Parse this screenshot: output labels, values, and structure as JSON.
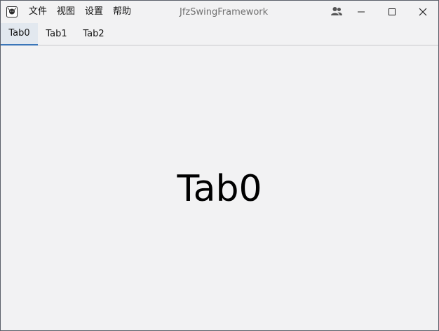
{
  "window": {
    "title": "JfzSwingFramework",
    "menu": [
      {
        "label": "文件"
      },
      {
        "label": "视图"
      },
      {
        "label": "设置"
      },
      {
        "label": "帮助"
      }
    ],
    "controls": {
      "users_icon": "users-icon",
      "minimize_icon": "minimize-icon",
      "maximize_icon": "maximize-icon",
      "close_icon": "close-icon"
    }
  },
  "tabs": [
    {
      "label": "Tab0",
      "selected": true
    },
    {
      "label": "Tab1",
      "selected": false
    },
    {
      "label": "Tab2",
      "selected": false
    }
  ],
  "content": {
    "heading": "Tab0"
  },
  "colors": {
    "background": "#f2f2f3",
    "accent": "#3a76b9",
    "active_tab_bg": "#e2e8ef",
    "title_text": "#707070",
    "text": "#111111"
  }
}
